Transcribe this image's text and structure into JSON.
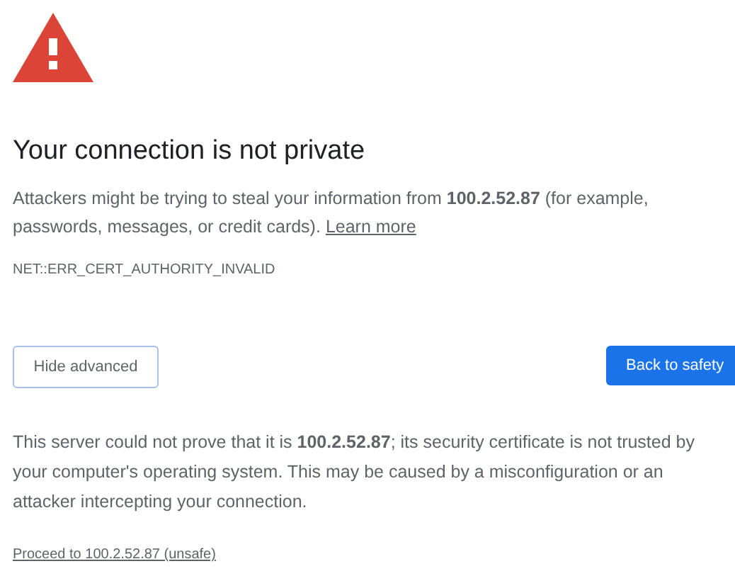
{
  "heading": "Your connection is not private",
  "intro": {
    "text": "Attackers might be trying to steal your information from **100.2.52.87** (for example, passwords, messages, or credit cards).",
    "link": "Learn more"
  },
  "error_code": "NET::ERR_CERT_AUTHORITY_INVALID",
  "buttons": {
    "secondary": "Hide advanced",
    "primary": "Back to safety"
  },
  "details": "This server could not prove that it is **100.2.52.87**; its security certificate is not trusted by your computer's operating system. This may be caused by a misconfiguration or an attacker intercepting your connection.",
  "proceed_link": "Proceed to 100.2.52.87 (unsafe)"
}
